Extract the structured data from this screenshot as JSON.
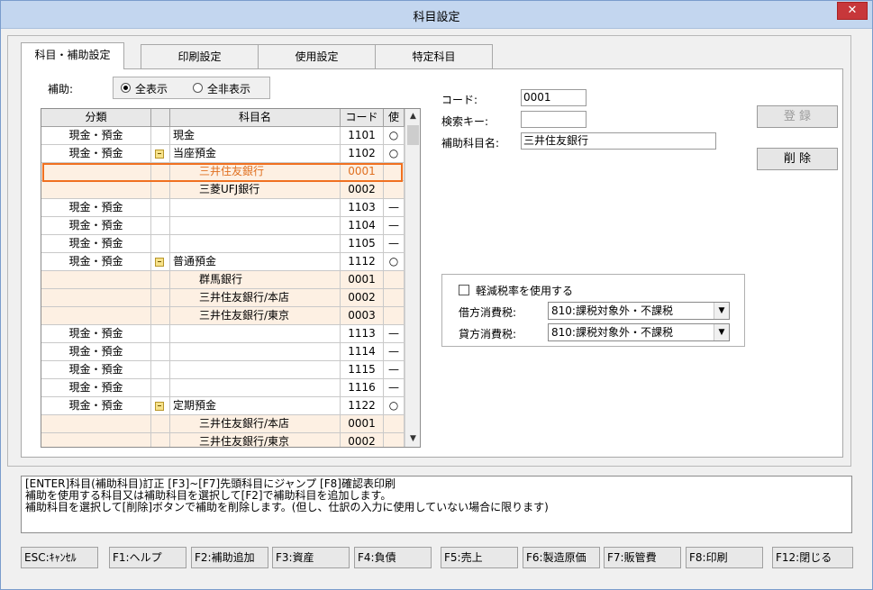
{
  "window": {
    "title": "科目設定",
    "close_label": "✕"
  },
  "tabs": [
    {
      "label": "科目・補助設定",
      "active": true
    },
    {
      "label": "印刷設定",
      "active": false
    },
    {
      "label": "使用設定",
      "active": false
    },
    {
      "label": "特定科目",
      "active": false
    }
  ],
  "filter": {
    "label": "補助:",
    "options": [
      "全表示",
      "全非表示"
    ],
    "selected": "全表示"
  },
  "grid": {
    "headers": [
      "分類",
      "",
      "科目名",
      "コード",
      "使"
    ],
    "rows": [
      {
        "cat": "現金・預金",
        "tree": false,
        "name": "現金",
        "code": "1101",
        "use": "○",
        "sub": false
      },
      {
        "cat": "現金・預金",
        "tree": true,
        "name": "当座預金",
        "code": "1102",
        "use": "○",
        "sub": false
      },
      {
        "cat": "",
        "tree": false,
        "name": "三井住友銀行",
        "code": "0001",
        "use": "",
        "sub": true
      },
      {
        "cat": "",
        "tree": false,
        "name": "三菱UFJ銀行",
        "code": "0002",
        "use": "",
        "sub": true
      },
      {
        "cat": "現金・預金",
        "tree": false,
        "name": "",
        "code": "1103",
        "use": "—",
        "sub": false
      },
      {
        "cat": "現金・預金",
        "tree": false,
        "name": "",
        "code": "1104",
        "use": "—",
        "sub": false
      },
      {
        "cat": "現金・預金",
        "tree": false,
        "name": "",
        "code": "1105",
        "use": "—",
        "sub": false
      },
      {
        "cat": "現金・預金",
        "tree": true,
        "name": "普通預金",
        "code": "1112",
        "use": "○",
        "sub": false
      },
      {
        "cat": "",
        "tree": false,
        "name": "群馬銀行",
        "code": "0001",
        "use": "",
        "sub": true
      },
      {
        "cat": "",
        "tree": false,
        "name": "三井住友銀行/本店",
        "code": "0002",
        "use": "",
        "sub": true
      },
      {
        "cat": "",
        "tree": false,
        "name": "三井住友銀行/東京",
        "code": "0003",
        "use": "",
        "sub": true
      },
      {
        "cat": "現金・預金",
        "tree": false,
        "name": "",
        "code": "1113",
        "use": "—",
        "sub": false
      },
      {
        "cat": "現金・預金",
        "tree": false,
        "name": "",
        "code": "1114",
        "use": "—",
        "sub": false
      },
      {
        "cat": "現金・預金",
        "tree": false,
        "name": "",
        "code": "1115",
        "use": "—",
        "sub": false
      },
      {
        "cat": "現金・預金",
        "tree": false,
        "name": "",
        "code": "1116",
        "use": "—",
        "sub": false
      },
      {
        "cat": "現金・預金",
        "tree": true,
        "name": "定期預金",
        "code": "1122",
        "use": "○",
        "sub": false
      },
      {
        "cat": "",
        "tree": false,
        "name": "三井住友銀行/本店",
        "code": "0001",
        "use": "",
        "sub": true
      },
      {
        "cat": "",
        "tree": false,
        "name": "三井住友銀行/東京",
        "code": "0002",
        "use": "",
        "sub": true
      }
    ]
  },
  "form": {
    "code_label": "コード:",
    "code_value": "0001",
    "search_label": "検索キー:",
    "search_value": "",
    "sub_name_label": "補助科目名:",
    "sub_name_value": "三井住友銀行"
  },
  "buttons": {
    "register": "登 録",
    "delete": "削 除"
  },
  "tax": {
    "reduced_rate_label": "軽減税率を使用する",
    "debit_label": "借方消費税:",
    "debit_value": "810:課税対象外・不課税",
    "credit_label": "貸方消費税:",
    "credit_value": "810:課税対象外・不課税"
  },
  "help": {
    "lines": [
      "[ENTER]科目(補助科目)訂正 [F3]~[F7]先頭科目にジャンプ [F8]確認表印刷",
      "補助を使用する科目又は補助科目を選択して[F2]で補助科目を追加します。",
      "補助科目を選択して[削除]ボタンで補助を削除します。(但し、仕訳の入力に使用していない場合に限ります)"
    ]
  },
  "fkeys": [
    "ESC:ｷｬﾝｾﾙ",
    "F1:ヘルプ",
    "F2:補助追加",
    "F3:資産",
    "F4:負債",
    "F5:売上",
    "F6:製造原価",
    "F7:販管費",
    "F8:印刷",
    "F12:閉じる"
  ]
}
